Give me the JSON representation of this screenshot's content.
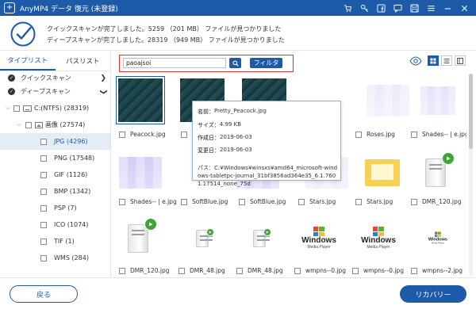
{
  "app": {
    "title": "AnyMP4 データ 復元 (未登録)",
    "accent_color": "#1d5aa8"
  },
  "titlebar_icons": [
    "cart-icon",
    "key-icon",
    "facebook-icon",
    "chat-icon",
    "save-icon",
    "menu-icon",
    "minimize-icon",
    "close-icon"
  ],
  "header": {
    "quick_scan_text": "クイックスキャンが完了しました。5259  （201 MB）  ファイルが見つかりました",
    "deep_scan_text": "ディープスキャンが完了しました。28319  （949 MB）  ファイルが見つかりました"
  },
  "sidebar": {
    "tabs": [
      "タイプリスト",
      "パスリスト"
    ],
    "quick_scan_label": "クイックスキャン",
    "deep_scan_label": "ディープスキャン",
    "drive_label": "C:(NTFS) (28319)",
    "images_label": "画像 (27574)",
    "extensions": [
      "JPG (4296)",
      "PNG (17548)",
      "GIF (1126)",
      "BMP (1342)",
      "PSP (7)",
      "ICO (1074)",
      "TIF (1)",
      "WMS (284)"
    ]
  },
  "toolbar": {
    "search_value": "paoajsoi",
    "filter_label": "フィルタ"
  },
  "files": [
    "Peacock.jpg",
    "Pr",
    "",
    "",
    "Roses.jpg",
    "Shades-- | e.jpg",
    "Shades-- | e.jpg",
    "SoftBlue.jpg",
    "SoftBlue.jpg",
    "Stars.jpg",
    "Stars.jpg",
    "DMR_120.jpg",
    "DMR_120.jpg",
    "DMR_48.jpg",
    "DMR_48.jpg",
    "wmpns--0.jpg",
    "wmpns--0.jpg",
    "wmpns--2.jpg"
  ],
  "tooltip": {
    "name_label": "名前：",
    "name_value": "Pretty_Peacock.jpg",
    "size_label": "サイズ：",
    "size_value": "4.99 KB",
    "created_label": "作成日：",
    "created_value": "2019-06-03",
    "modified_label": "変更日：",
    "modified_value": "2019-06-03",
    "path_label": "パス：",
    "path_value": "C:¥Windows¥winsxs¥amd64_microsoft-windows-tabletpc-journal_31bf3856ad364e35_6.1.7601.17514_none_75d"
  },
  "footer": {
    "back_label": "戻る",
    "recover_label": "リカバリー"
  }
}
